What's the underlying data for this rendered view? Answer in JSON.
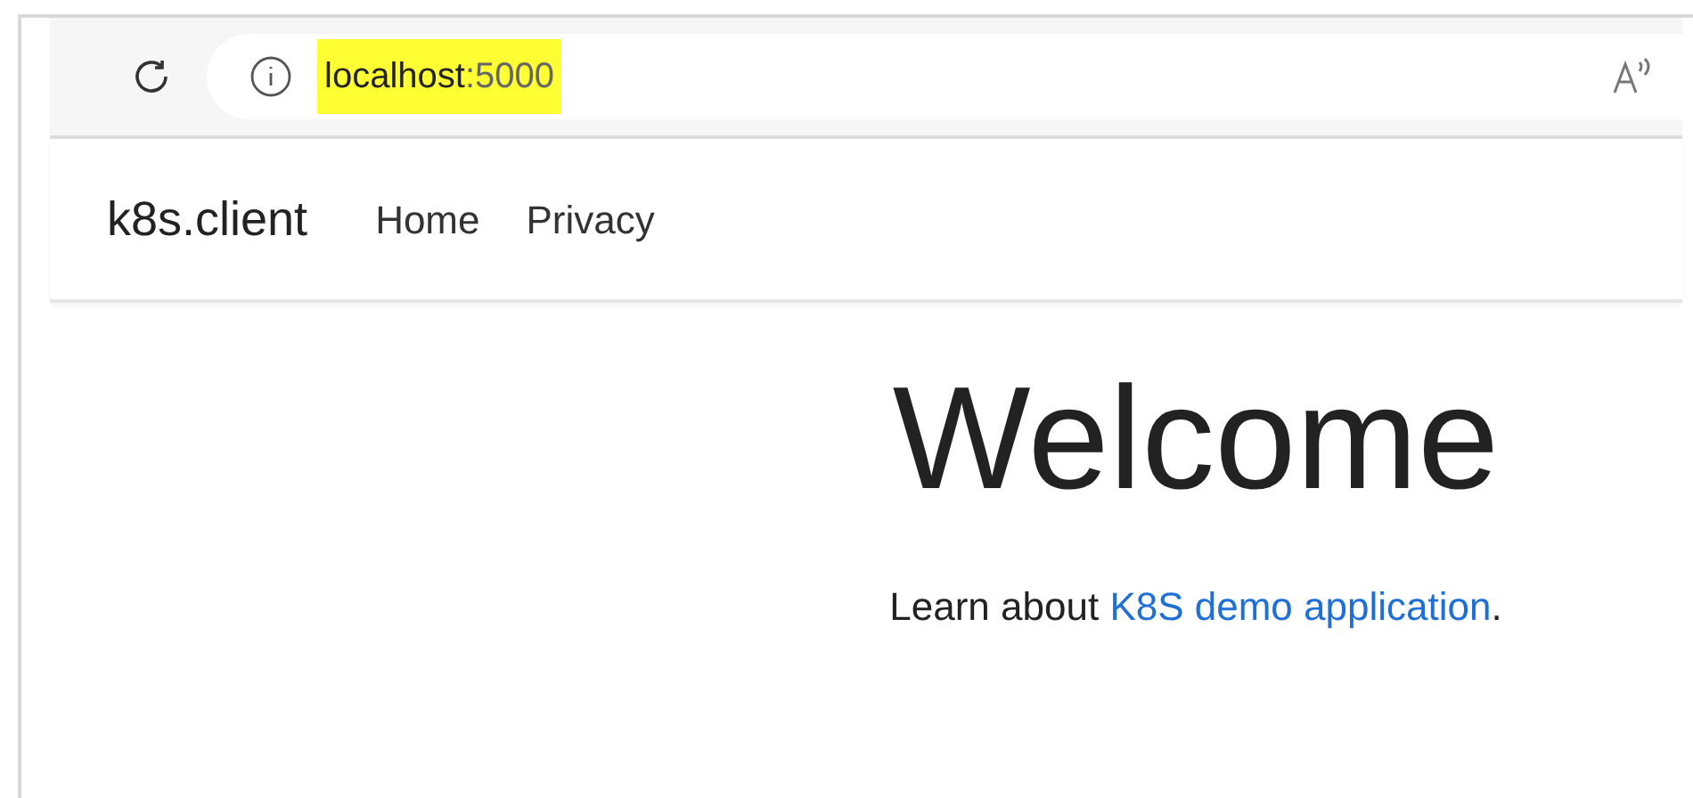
{
  "address_bar": {
    "host": "localhost",
    "port": ":5000"
  },
  "navbar": {
    "brand": "k8s.client",
    "links": [
      "Home",
      "Privacy"
    ]
  },
  "main": {
    "heading": "Welcome",
    "intro": "Learn about ",
    "link": "K8S demo application",
    "end": "."
  }
}
